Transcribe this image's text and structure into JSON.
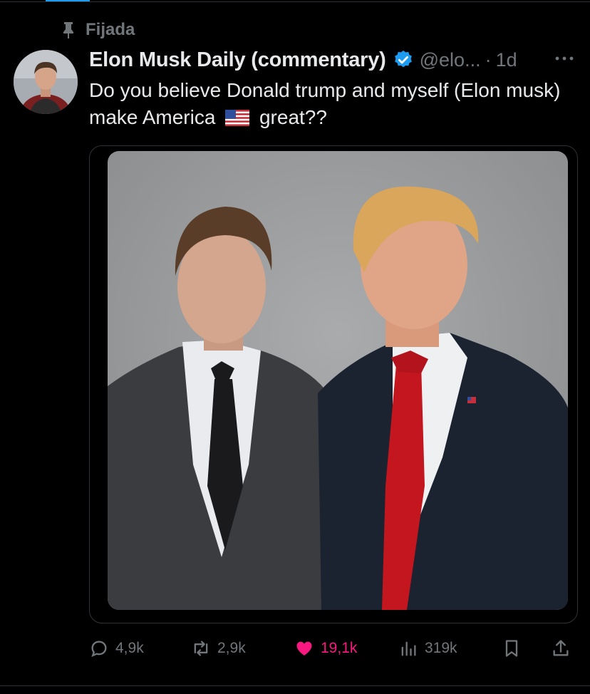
{
  "pinned_label": "Fijada",
  "tweet": {
    "display_name": "Elon Musk Daily (commentary)",
    "handle": "@elo...",
    "separator": "·",
    "time": "1d",
    "text_before_flag": "Do you believe Donald trump and myself (Elon musk) make America",
    "text_after_flag": "great??",
    "verified": true
  },
  "actions": {
    "replies": "4,9k",
    "reposts": "2,9k",
    "likes": "19,1k",
    "views": "319k"
  },
  "colors": {
    "background": "#000000",
    "text_primary": "#e7e9ea",
    "text_secondary": "#71767b",
    "verified_blue": "#1d9bf0",
    "like_pink": "#f91880"
  },
  "icons": [
    "pin-icon",
    "verified-badge-icon",
    "more-options-icon",
    "us-flag-emoji",
    "reply-icon",
    "repost-icon",
    "heart-icon",
    "views-chart-icon",
    "bookmark-icon",
    "share-icon"
  ]
}
